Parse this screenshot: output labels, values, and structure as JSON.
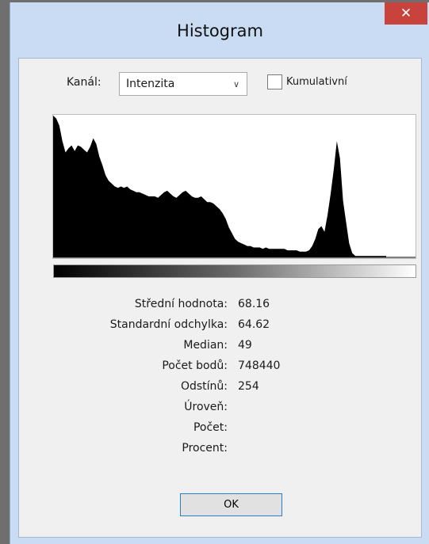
{
  "window": {
    "title": "Histogram",
    "close_glyph": "✕"
  },
  "channel": {
    "label": "Kanál:",
    "selected": "Intenzita",
    "arrow_icon": "chevron-down-icon"
  },
  "cumulative": {
    "label": "Kumulativní",
    "checked": false
  },
  "chart_data": {
    "type": "area",
    "x_range": [
      0,
      255
    ],
    "y_range": [
      0,
      1
    ],
    "values": [
      1.0,
      0.98,
      0.93,
      0.82,
      0.74,
      0.77,
      0.79,
      0.75,
      0.79,
      0.78,
      0.76,
      0.74,
      0.78,
      0.84,
      0.8,
      0.71,
      0.65,
      0.58,
      0.54,
      0.52,
      0.5,
      0.49,
      0.5,
      0.49,
      0.5,
      0.48,
      0.47,
      0.46,
      0.46,
      0.45,
      0.44,
      0.43,
      0.43,
      0.43,
      0.42,
      0.44,
      0.46,
      0.47,
      0.45,
      0.43,
      0.42,
      0.44,
      0.46,
      0.47,
      0.45,
      0.43,
      0.42,
      0.42,
      0.43,
      0.41,
      0.39,
      0.39,
      0.38,
      0.36,
      0.34,
      0.31,
      0.27,
      0.21,
      0.17,
      0.13,
      0.11,
      0.1,
      0.09,
      0.08,
      0.08,
      0.07,
      0.07,
      0.07,
      0.06,
      0.07,
      0.06,
      0.06,
      0.06,
      0.06,
      0.06,
      0.06,
      0.05,
      0.05,
      0.05,
      0.05,
      0.04,
      0.04,
      0.04,
      0.05,
      0.08,
      0.13,
      0.2,
      0.22,
      0.18,
      0.3,
      0.45,
      0.62,
      0.82,
      0.7,
      0.4,
      0.25,
      0.1,
      0.03,
      0.01,
      0.01,
      0.01,
      0.01,
      0.01,
      0.01,
      0.01,
      0.01,
      0.01,
      0.01,
      0.01
    ],
    "gradient_stops": [
      "#000000",
      "#6a6a6a",
      "#ffffff"
    ]
  },
  "stats": [
    {
      "label": "Střední hodnota:",
      "value": "68.16"
    },
    {
      "label": "Standardní odchylka:",
      "value": "64.62"
    },
    {
      "label": "Median:",
      "value": "49"
    },
    {
      "label": "Počet bodů:",
      "value": "748440"
    },
    {
      "label": "Odstínů:",
      "value": "254"
    },
    {
      "label": "Úroveň:",
      "value": ""
    },
    {
      "label": "Počet:",
      "value": ""
    },
    {
      "label": "Procent:",
      "value": ""
    }
  ],
  "ok_label": "OK",
  "colors": {
    "title_bar": "#c9dcf3",
    "close_button": "#c7433c",
    "dialog_bg": "#f0f0f0",
    "histogram_fill": "#000000",
    "button_border": "#2c7cd3"
  }
}
